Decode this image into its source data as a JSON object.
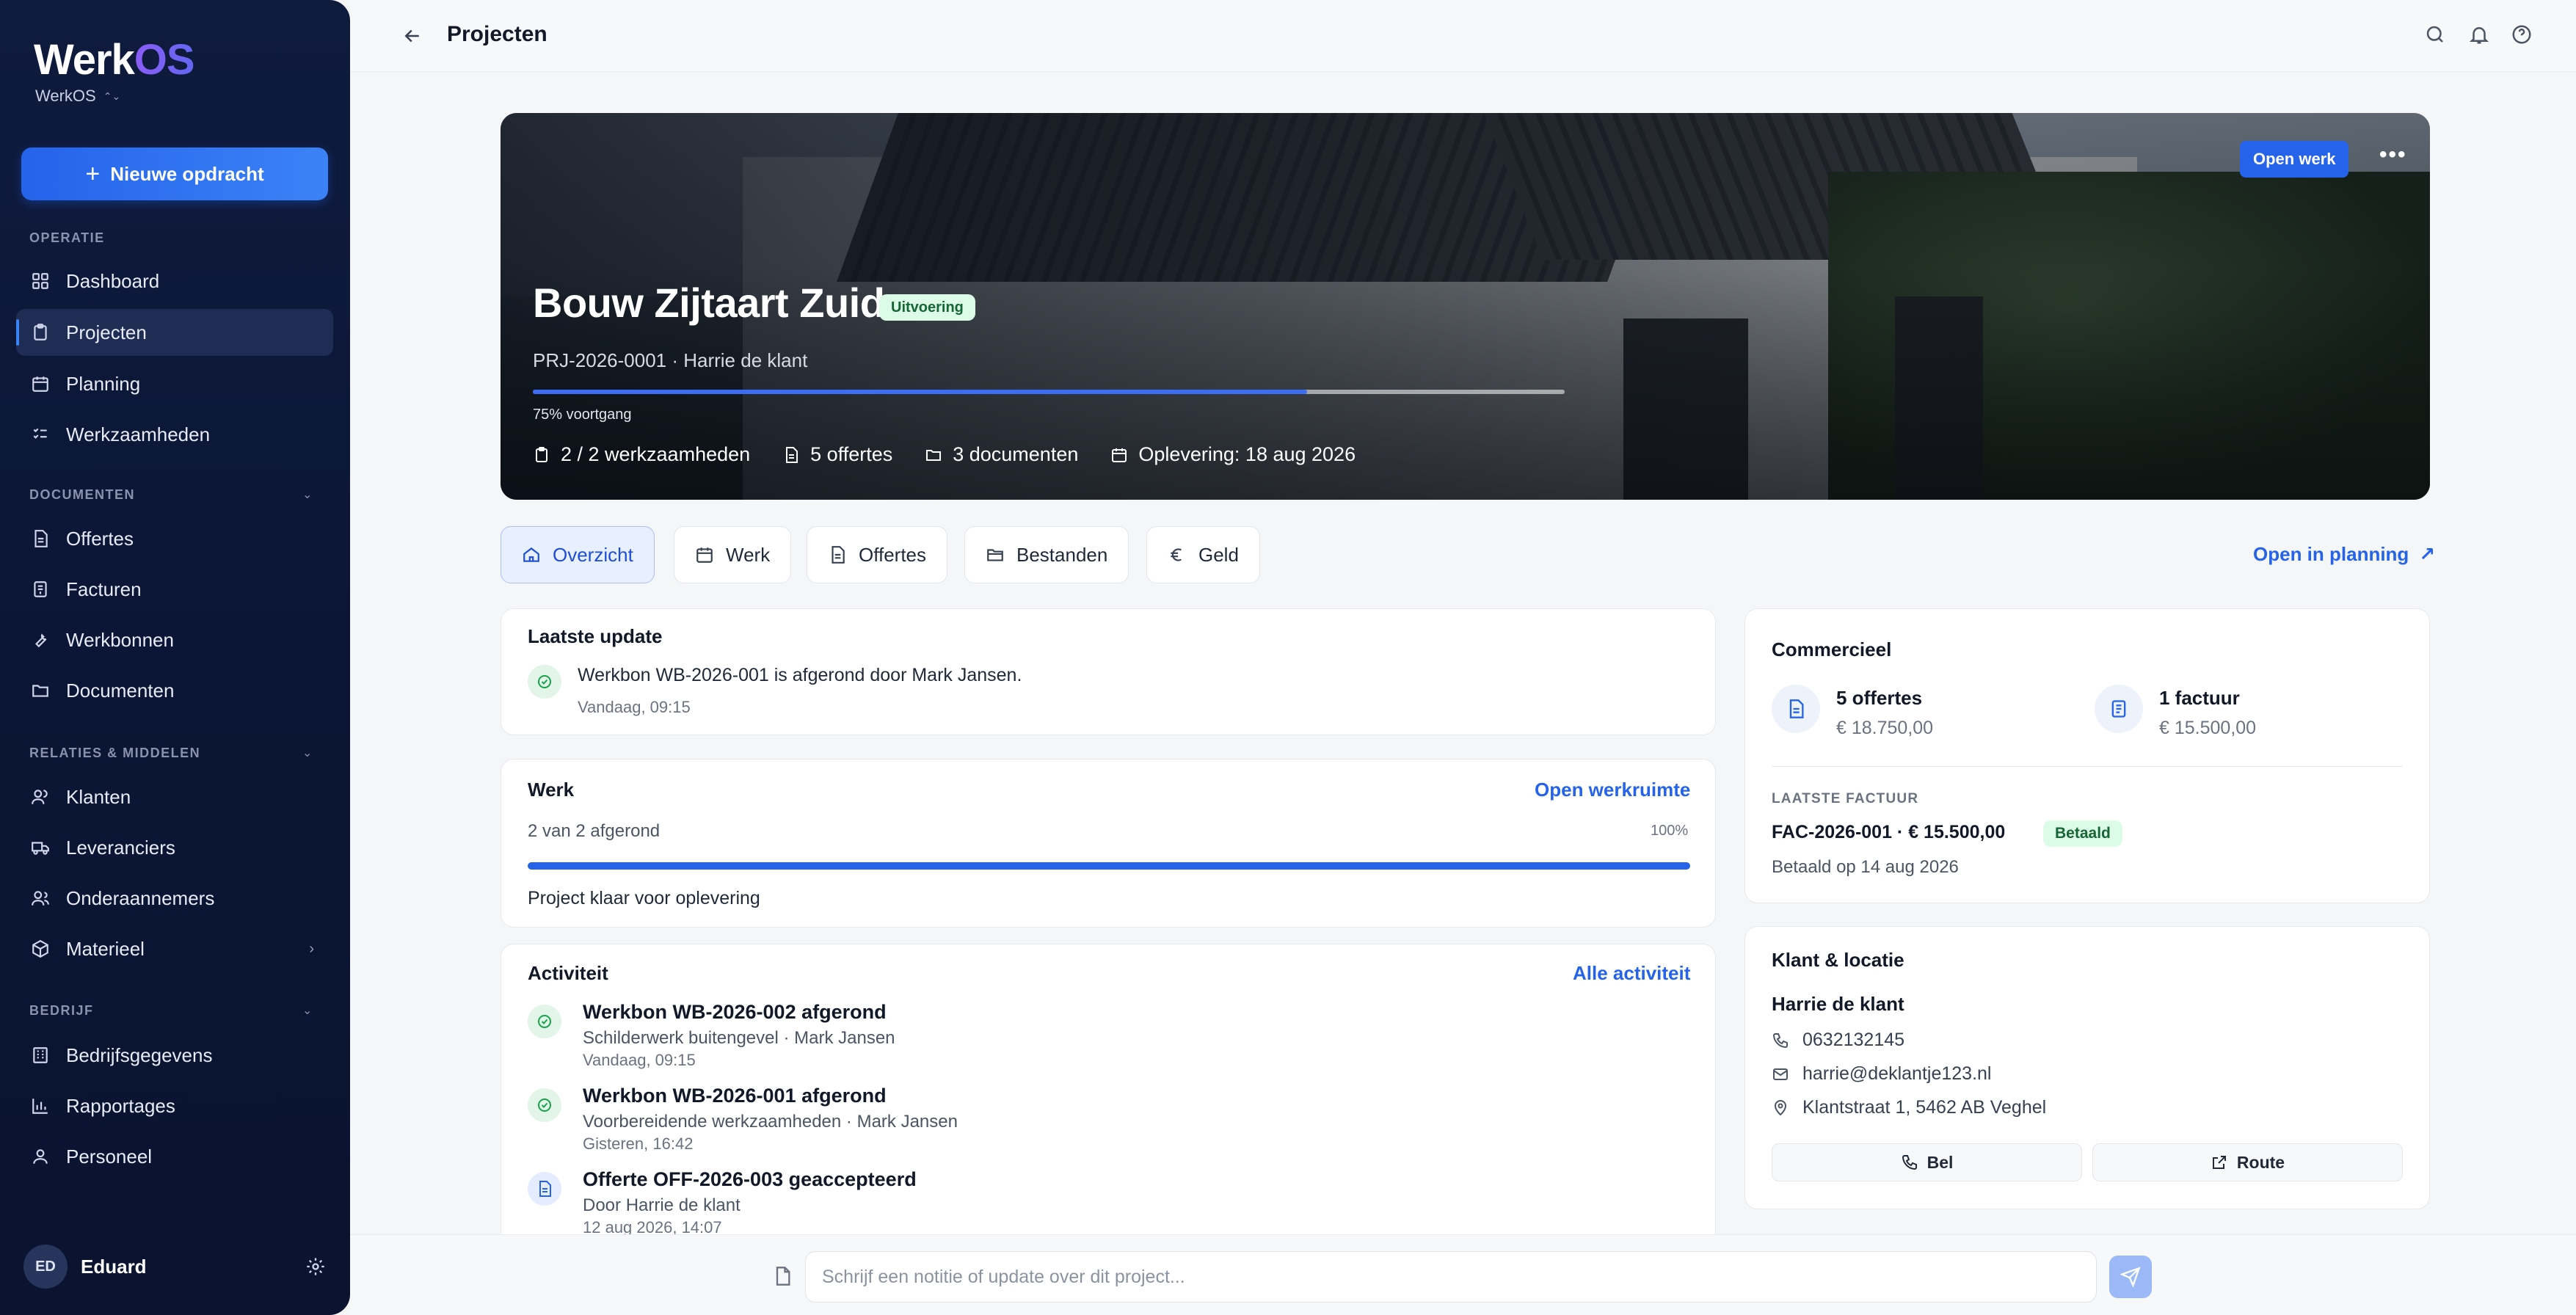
{
  "app": {
    "logo_main": "Werk",
    "logo_accent": "OS",
    "workspace": "WerkOS"
  },
  "sidebar": {
    "new_button": "Nieuwe opdracht",
    "sections": {
      "operatie": "OPERATIE",
      "documenten": "DOCUMENTEN",
      "relaties": "RELATIES & MIDDELEN",
      "bedrijf": "BEDRIJF"
    },
    "items": {
      "dashboard": "Dashboard",
      "projecten": "Projecten",
      "planning": "Planning",
      "werkzaamheden": "Werkzaamheden",
      "offertes": "Offertes",
      "facturen": "Facturen",
      "werkbonnen": "Werkbonnen",
      "documenten": "Documenten",
      "klanten": "Klanten",
      "leveranciers": "Leveranciers",
      "onderaannemers": "Onderaannemers",
      "materieel": "Materieel",
      "bedrijfsgegevens": "Bedrijfsgegevens",
      "rapportages": "Rapportages",
      "personeel": "Personeel"
    },
    "user": {
      "initials": "ED",
      "name": "Eduard"
    }
  },
  "topbar": {
    "title": "Projecten"
  },
  "hero": {
    "open_button": "Open werk",
    "more": "•••",
    "title": "Bouw Zijtaart Zuid",
    "status": "Uitvoering",
    "subtitle": "PRJ-2026-0001 · Harrie de klant",
    "progress": 0.75,
    "progress_label": "75% voortgang",
    "meta": {
      "tasks": "2 / 2 werkzaamheden",
      "quotes": "5 offertes",
      "documents": "3 documenten",
      "delivery": "Oplevering: 18 aug 2026"
    }
  },
  "tabs": {
    "overzicht": "Overzicht",
    "werk": "Werk",
    "offertes": "Offertes",
    "bestanden": "Bestanden",
    "geld": "Geld",
    "planning_link": "Open in planning"
  },
  "latest_update": {
    "title": "Laatste update",
    "text": "Werkbon WB-2026-001 is afgerond door Mark Jansen.",
    "time": "Vandaag, 09:15"
  },
  "work": {
    "title": "Werk",
    "link": "Open werkruimte",
    "summary": "2 van 2 afgerond",
    "percent_text": "100%",
    "progress": 1.0,
    "status": "Project klaar voor oplevering"
  },
  "activity": {
    "title": "Activiteit",
    "link": "Alle activiteit",
    "items": [
      {
        "title": "Werkbon WB-2026-002 afgerond",
        "sub": "Schilderwerk buitengevel · Mark Jansen",
        "time": "Vandaag, 09:15"
      },
      {
        "title": "Werkbon WB-2026-001 afgerond",
        "sub": "Voorbereidende werkzaamheden · Mark Jansen",
        "time": "Gisteren, 16:42"
      },
      {
        "title": "Offerte OFF-2026-003 geaccepteerd",
        "sub": "Door Harrie de klant",
        "time": "12 aug 2026, 14:07"
      }
    ]
  },
  "commercial": {
    "title": "Commercieel",
    "quotes_count": "5 offertes",
    "quotes_amount": "€ 18.750,00",
    "invoices_count": "1 factuur",
    "invoices_amount": "€ 15.500,00",
    "last_invoice_label": "LAATSTE FACTUUR",
    "last_invoice": "FAC-2026-001 · € 15.500,00",
    "paid_badge": "Betaald",
    "paid_on": "Betaald op 14 aug 2026"
  },
  "client": {
    "title": "Klant & locatie",
    "name": "Harrie de klant",
    "phone": "0632132145",
    "email": "harrie@deklantje123.nl",
    "address": "Klantstraat 1, 5462 AB Veghel",
    "call_button": "Bel",
    "route_button": "Route"
  },
  "note": {
    "placeholder": "Schrijf een notitie of update over dit project..."
  }
}
